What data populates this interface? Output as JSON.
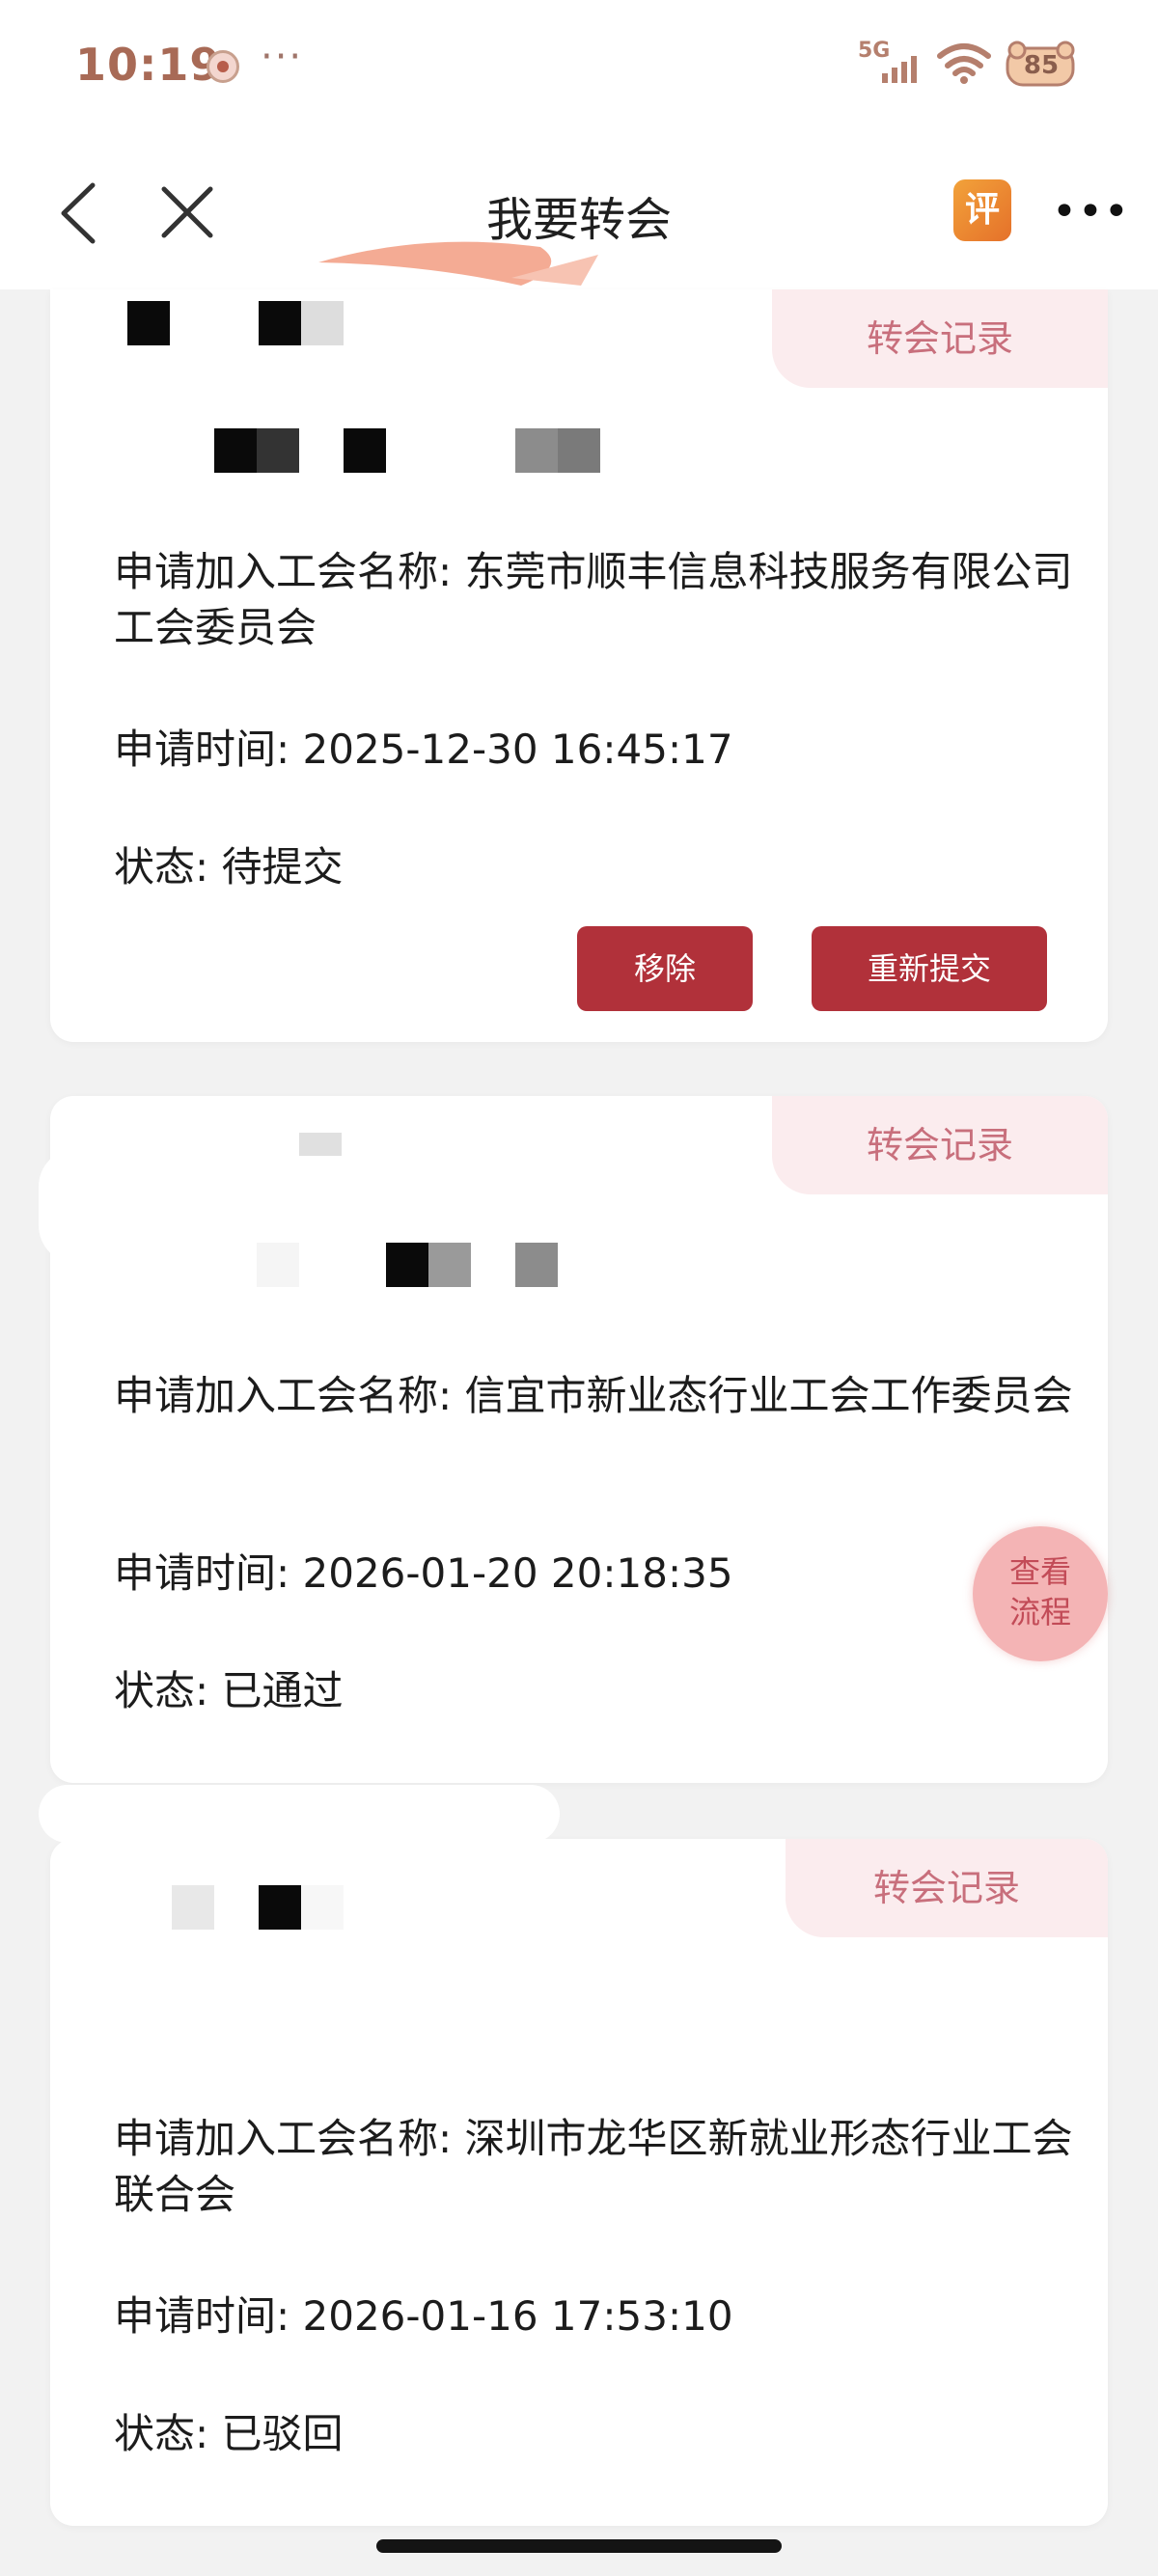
{
  "status_bar": {
    "time": "10:19",
    "dots": "···",
    "network": "5G",
    "battery": "85"
  },
  "nav": {
    "title": "我要转会",
    "rate_icon_text": "评",
    "more_icon": "•••"
  },
  "cards": [
    {
      "tag": "转会记录",
      "union_name": "申请加入工会名称: 东莞市顺丰信息科技服务有限公司工会委员会",
      "apply_time": "申请时间: 2025-12-30 16:45:17",
      "status": "状态: 待提交",
      "buttons": [
        "移除",
        "重新提交"
      ]
    },
    {
      "tag": "转会记录",
      "union_name": "申请加入工会名称: 信宜市新业态行业工会工作委员会",
      "apply_time": "申请时间: 2026-01-20 20:18:35",
      "status": "状态: 已通过"
    },
    {
      "tag": "转会记录",
      "union_name": "申请加入工会名称: 深圳市龙华区新就业形态行业工会联合会",
      "apply_time": "申请时间: 2026-01-16 17:53:10",
      "status": "状态: 已驳回"
    }
  ],
  "fab": {
    "line1": "查看",
    "line2": "流程"
  },
  "colors": {
    "accent": "#b1313a",
    "tag_bg": "#fbecee",
    "tag_text": "#c86f7c",
    "fab_bg": "#f4b4b5"
  }
}
